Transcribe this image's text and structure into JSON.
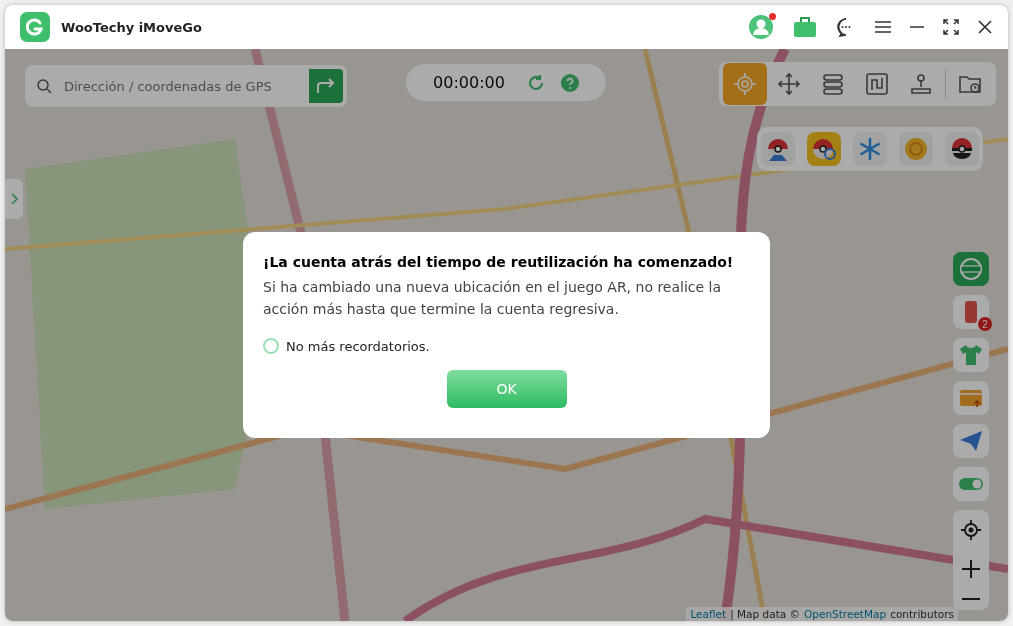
{
  "window": {
    "title": "WooTechy iMoveGo",
    "notification_dot": true
  },
  "search": {
    "placeholder": "Dirección / coordenadas de GPS"
  },
  "timer": {
    "value": "00:00:00"
  },
  "mode_tools": [
    {
      "kind": "teleport",
      "selected": true
    },
    {
      "kind": "move",
      "selected": false
    },
    {
      "kind": "multi",
      "selected": false
    },
    {
      "kind": "route",
      "selected": false
    },
    {
      "kind": "joystick",
      "selected": false
    },
    {
      "kind": "history",
      "selected": false
    }
  ],
  "game_tools": [
    {
      "kind": "ball-map",
      "selected": false
    },
    {
      "kind": "ball-search",
      "selected": true
    },
    {
      "kind": "snowflake",
      "selected": false
    },
    {
      "kind": "coin",
      "selected": false
    },
    {
      "kind": "ball-dark",
      "selected": false
    }
  ],
  "side_tools": [
    {
      "kind": "dns"
    },
    {
      "kind": "phone",
      "badge": "2"
    },
    {
      "kind": "shirt"
    },
    {
      "kind": "card"
    },
    {
      "kind": "send"
    },
    {
      "kind": "toggle"
    }
  ],
  "dialog": {
    "title": "¡La cuenta atrás del tiempo de reutilización ha comenzado!",
    "message": "Si ha cambiado una nueva ubicación en el juego AR, no realice la acción más hasta que termine la cuenta regresiva.",
    "reminder": {
      "label": "No más recordatorios.",
      "checked": false
    },
    "button": "OK"
  },
  "attribution": [
    {
      "text": "Leaflet",
      "link": true
    },
    {
      "text": "| Map data ©",
      "link": false
    },
    {
      "text": "OpenStreetMap",
      "link": true
    },
    {
      "text": "contributors",
      "link": false
    }
  ]
}
